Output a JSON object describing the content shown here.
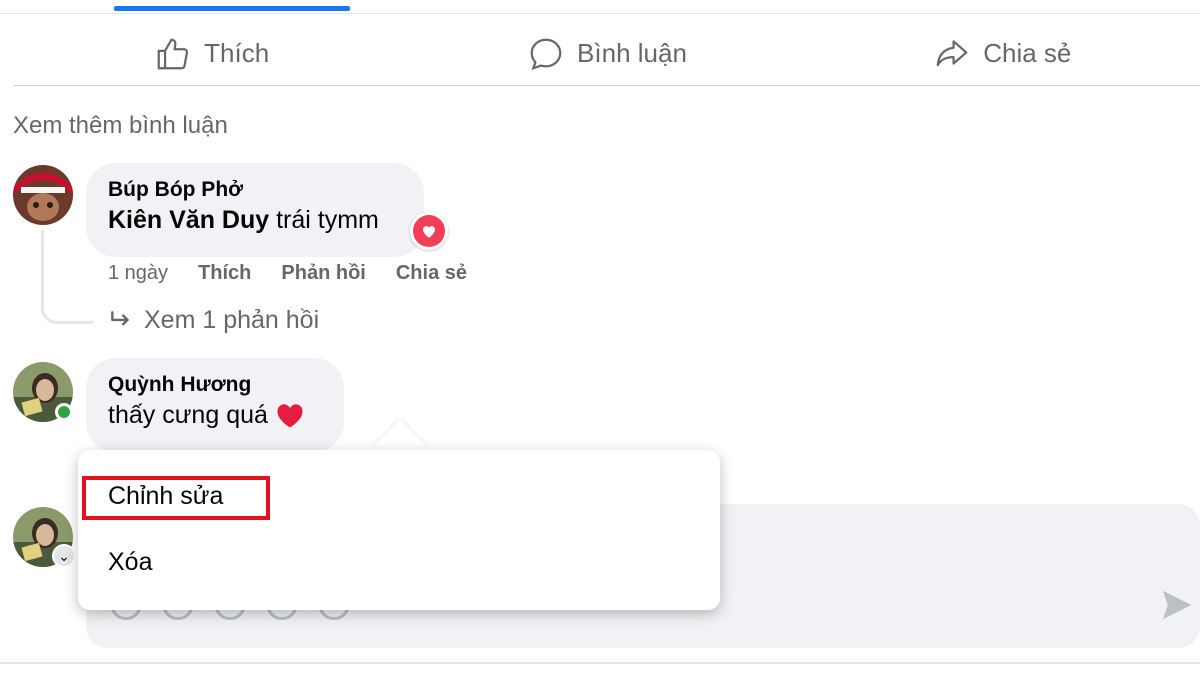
{
  "actions": {
    "like": "Thích",
    "comment": "Bình luận",
    "share": "Chia sẻ"
  },
  "view_more_comments": "Xem thêm bình luận",
  "comments": [
    {
      "author": "Búp Bóp Phở",
      "mention": "Kiên Văn Duy",
      "text": " trái tymm",
      "reaction": "heart-reaction-icon",
      "time": "1 ngày",
      "like": "Thích",
      "reply": "Phản hồi",
      "share": "Chia sẻ",
      "view_replies": "Xem 1 phản hồi"
    },
    {
      "author": "Quỳnh Hương",
      "text": "thấy cưng quá",
      "emoji": "❤️",
      "online": true
    }
  ],
  "context_menu": {
    "edit": "Chỉnh sửa",
    "delete": "Xóa"
  },
  "colors": {
    "accent": "#1877f2",
    "highlight": "#e3101e",
    "reaction": "#f33e58",
    "online": "#31a24c"
  }
}
